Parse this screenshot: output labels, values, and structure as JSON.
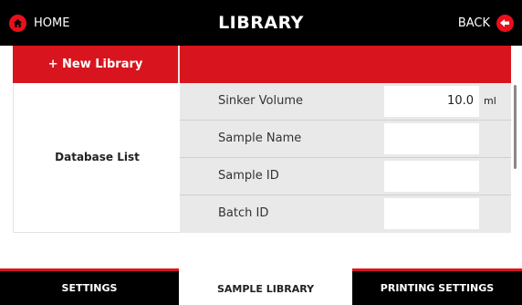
{
  "header": {
    "home_label": "HOME",
    "title": "LIBRARY",
    "back_label": "BACK",
    "home_icon": "home-icon",
    "back_icon": "back-arrow-icon"
  },
  "library": {
    "new_library_label": "+ New Library",
    "database_list_label": "Database  List"
  },
  "fields": [
    {
      "label": "Sinker Volume",
      "value": "10.0",
      "unit": "ml"
    },
    {
      "label": "Sample Name",
      "value": "",
      "unit": ""
    },
    {
      "label": "Sample ID",
      "value": "",
      "unit": ""
    },
    {
      "label": "Batch ID",
      "value": "",
      "unit": ""
    }
  ],
  "tabs": [
    {
      "label": "SETTINGS",
      "active": false
    },
    {
      "label": "SAMPLE LIBRARY",
      "active": true
    },
    {
      "label": "PRINTING SETTINGS",
      "active": false
    }
  ],
  "colors": {
    "accent_red": "#d8151f",
    "header_black": "#000000",
    "panel_gray": "#e9e9e9"
  }
}
